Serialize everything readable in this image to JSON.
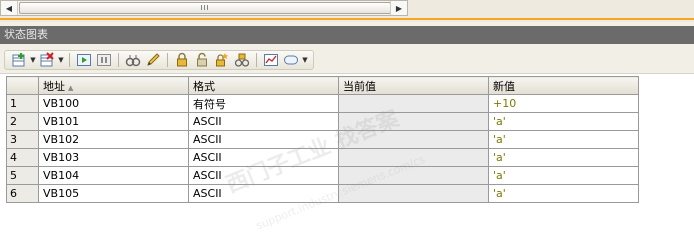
{
  "scrollbar": {
    "left_arrow": "◀",
    "right_arrow": "▶",
    "thumb_grip": "III"
  },
  "panel": {
    "title": "状态图表"
  },
  "toolbar": {
    "icons": [
      "insert-row-icon",
      "delete-row-icon",
      "chart-run-icon",
      "chart-pause-icon",
      "read-icon",
      "write-icon",
      "force-icon",
      "unforce-icon",
      "unforce-all-icon",
      "read-all-forced-icon",
      "trend-view-icon",
      "tooltip-icon"
    ]
  },
  "table": {
    "headers": {
      "rownum": "",
      "address": "地址",
      "format": "格式",
      "current": "当前值",
      "new": "新值"
    },
    "rows": [
      {
        "num": "1",
        "address": "VB100",
        "format": "有符号",
        "current": "",
        "new": "+10"
      },
      {
        "num": "2",
        "address": "VB101",
        "format": "ASCII",
        "current": "",
        "new": "'a'"
      },
      {
        "num": "3",
        "address": "VB102",
        "format": "ASCII",
        "current": "",
        "new": "'a'"
      },
      {
        "num": "4",
        "address": "VB103",
        "format": "ASCII",
        "current": "",
        "new": "'a'"
      },
      {
        "num": "5",
        "address": "VB104",
        "format": "ASCII",
        "current": "",
        "new": "'a'"
      },
      {
        "num": "6",
        "address": "VB105",
        "format": "ASCII",
        "current": "",
        "new": "'a'"
      }
    ]
  },
  "watermark": {
    "text": "西门子工业 找答案",
    "url": "support.industry.siemens.com/cs"
  },
  "colors": {
    "accent": "#f5a623",
    "title_bar": "#6b6b6b",
    "new_value": "#7a7a00"
  }
}
